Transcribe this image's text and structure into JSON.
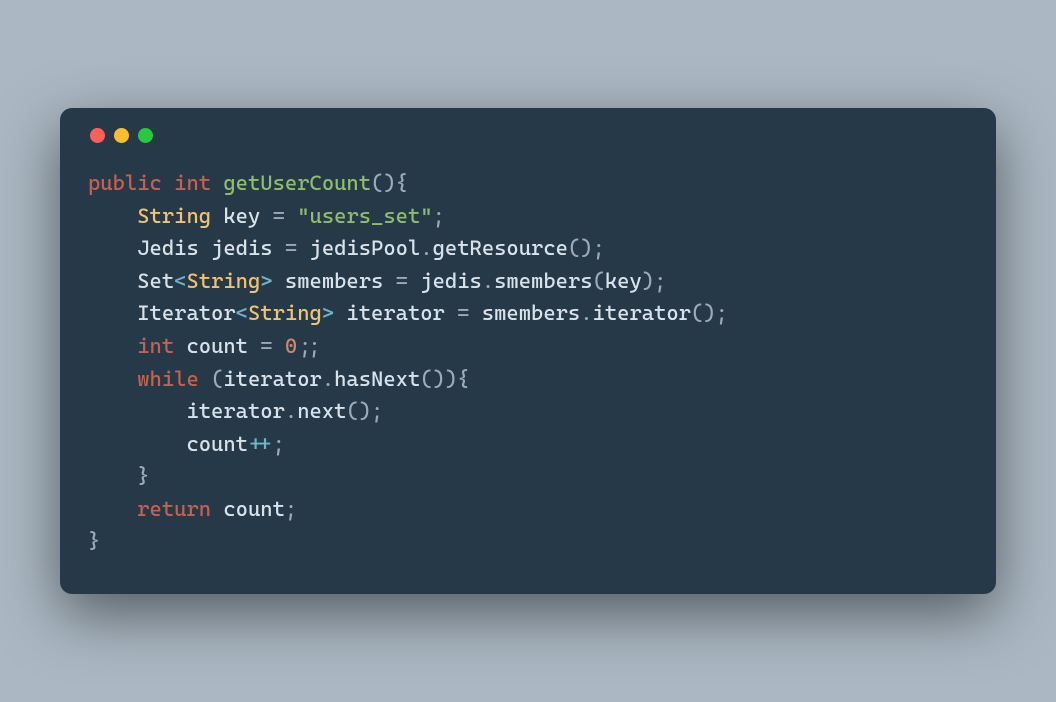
{
  "window": {
    "traffic_lights": [
      "red",
      "yellow",
      "green"
    ]
  },
  "code": {
    "t_public": "public",
    "t_int": "int",
    "t_fn": "getUserCount",
    "t_string": "String",
    "t_key": "key",
    "t_eq": "=",
    "t_users_set": "\"users_set\"",
    "t_jedis_type": "Jedis",
    "t_jedis_var": "jedis",
    "t_jedispool": "jedisPool",
    "t_getresource": "getResource",
    "t_set": "Set",
    "t_smembers_var": "smembers",
    "t_smembers_call": "smembers",
    "t_iterator_type": "Iterator",
    "t_iterator_var": "iterator",
    "t_iterator_call": "iterator",
    "t_int2": "int",
    "t_count": "count",
    "t_zero": "0",
    "t_while": "while",
    "t_hasnext": "hasNext",
    "t_next": "next",
    "t_pp": "++",
    "t_return": "return",
    "t_lt": "<",
    "t_gt": ">"
  }
}
